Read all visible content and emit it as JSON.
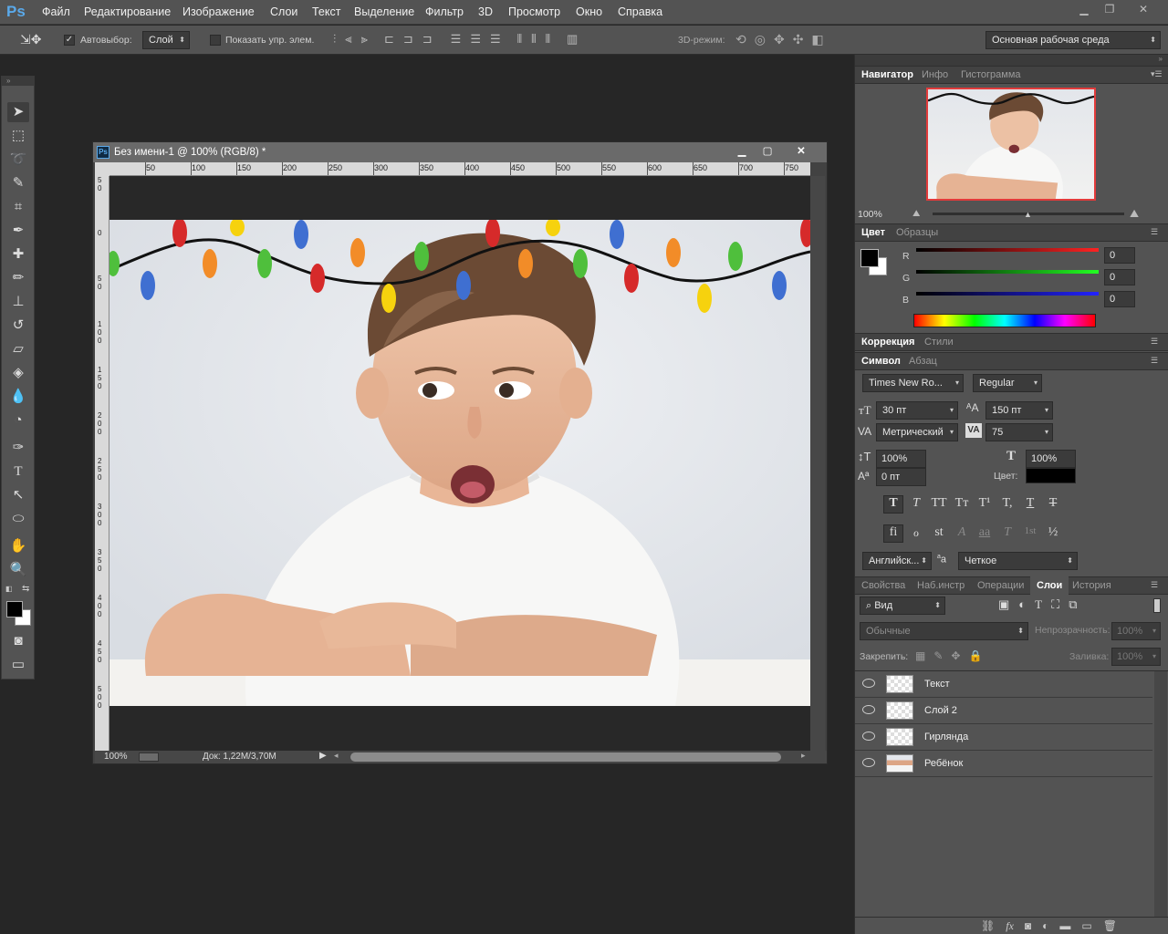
{
  "app": {
    "logo": "Ps"
  },
  "menu": [
    "Файл",
    "Редактирование",
    "Изображение",
    "Слои",
    "Текст",
    "Выделение",
    "Фильтр",
    "3D",
    "Просмотр",
    "Окно",
    "Справка"
  ],
  "options": {
    "autoselect_label": "Автовыбор:",
    "autoselect_value": "Слой",
    "show_controls_label": "Показать упр. элем.",
    "mode3d_label": "3D-режим:",
    "workspace": "Основная рабочая среда"
  },
  "document": {
    "title": "Без имени-1 @ 100% (RGB/8) *",
    "ruler_h": [
      "50",
      "100",
      "150",
      "200",
      "250",
      "300",
      "350",
      "400",
      "450",
      "500",
      "550",
      "600",
      "650",
      "700",
      "750"
    ],
    "ruler_v": [
      "5 0",
      "0",
      "5 0",
      "1 0 0",
      "1 5 0",
      "2 0 0",
      "2 5 0",
      "3 0 0",
      "3 5 0",
      "4 0 0",
      "4 5 0",
      "5 0 0"
    ],
    "zoom": "100%",
    "doc_info": "Док: 1,22M/3,70M"
  },
  "navigator": {
    "tabs": [
      "Навигатор",
      "Инфо",
      "Гистограмма"
    ],
    "zoom": "100%"
  },
  "color_panel": {
    "tabs": [
      "Цвет",
      "Образцы"
    ],
    "channels": [
      {
        "label": "R",
        "value": "0",
        "color": "#e22a2a"
      },
      {
        "label": "G",
        "value": "0",
        "color": "#2fce2f"
      },
      {
        "label": "B",
        "value": "0",
        "color": "#2a3ee6"
      }
    ]
  },
  "adjust_panel": {
    "tabs": [
      "Коррекция",
      "Стили"
    ]
  },
  "character": {
    "tabs": [
      "Символ",
      "Абзац"
    ],
    "font_family": "Times New Ro...",
    "font_style": "Regular",
    "size": "30 пт",
    "leading": "150 пт",
    "kerning": "Метрический",
    "tracking": "75",
    "vscale": "100%",
    "hscale": "100%",
    "baseline": "0 пт",
    "color_label": "Цвет:",
    "style_buttons": [
      "T",
      "T",
      "TT",
      "Tт",
      "T¹",
      "T,",
      "T",
      "T"
    ],
    "opentype_buttons": [
      "fi",
      "ℴ",
      "st",
      "A",
      "aa",
      "T",
      "1st",
      "½"
    ],
    "language": "Английск...",
    "aa_label": "a",
    "antialias": "Четкое"
  },
  "layers_panel": {
    "tabs": [
      "Свойства",
      "Наб.инстр",
      "Операции",
      "Слои",
      "История"
    ],
    "filter": "Вид",
    "blend": "Обычные",
    "opacity_label": "Непрозрачность:",
    "opacity": "100%",
    "lock_label": "Закрепить:",
    "fill_label": "Заливка:",
    "fill": "100%",
    "layers": [
      "Текст",
      "Слой 2",
      "Гирлянда",
      "Ребёнок"
    ]
  }
}
